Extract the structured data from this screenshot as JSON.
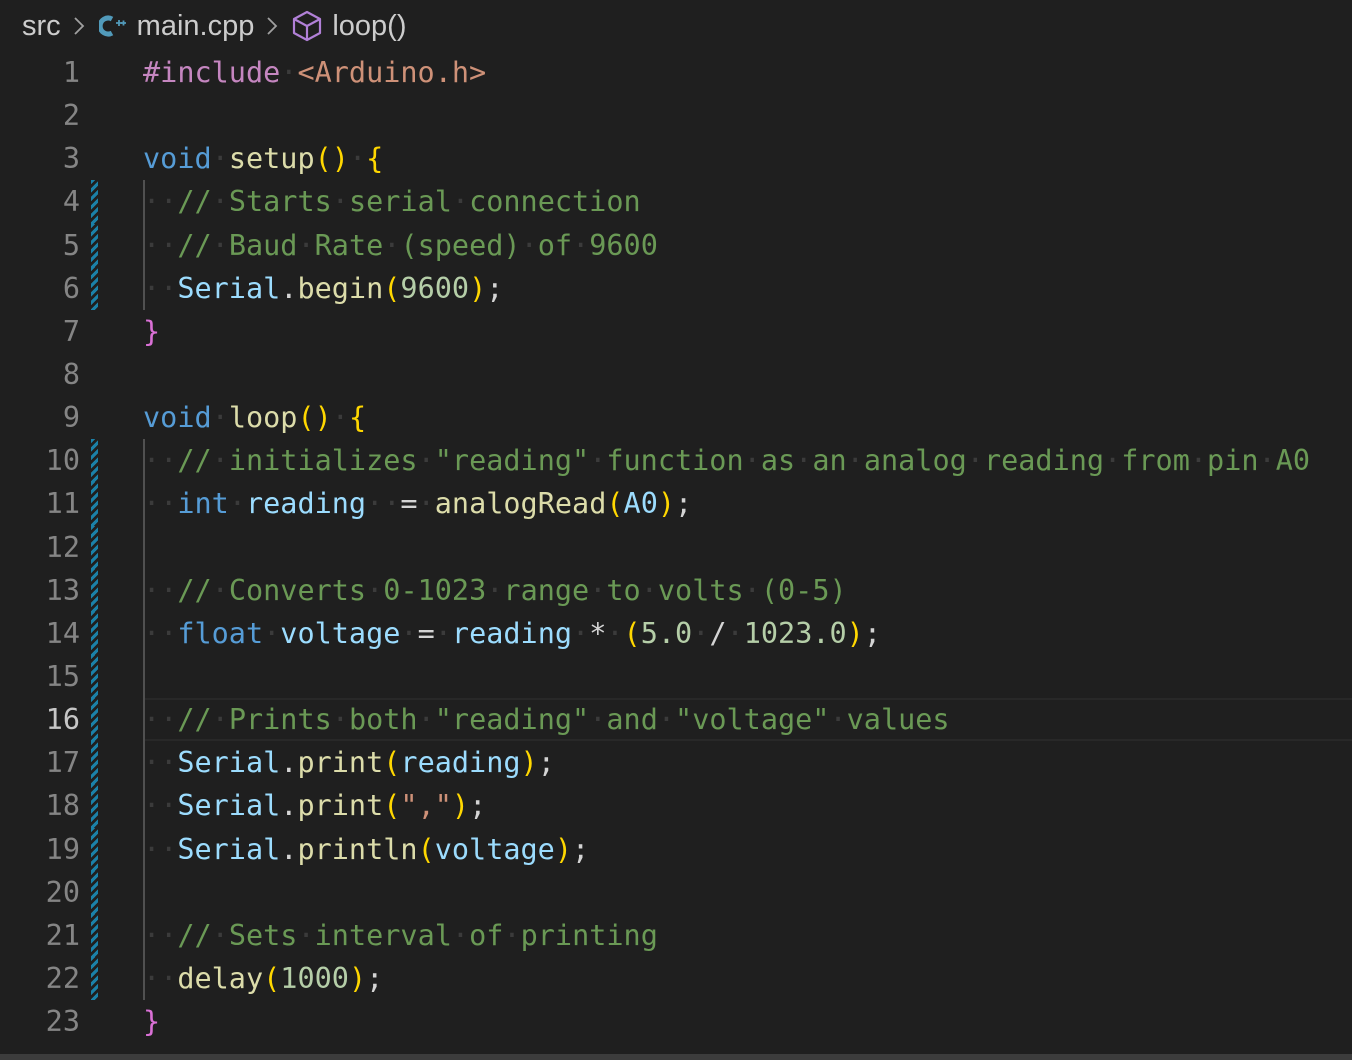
{
  "breadcrumb": {
    "folder": "src",
    "file": "main.cpp",
    "symbol": "loop()",
    "file_icon": "cpp-file-icon",
    "symbol_icon": "method-cube-icon"
  },
  "editor": {
    "language": "cpp",
    "current_line": 16,
    "lines": [
      {
        "n": "1",
        "text": "#include <Arduino.h>"
      },
      {
        "n": "2",
        "text": ""
      },
      {
        "n": "3",
        "text": "void setup() {"
      },
      {
        "n": "4",
        "text": "  // Starts serial connection"
      },
      {
        "n": "5",
        "text": "  // Baud Rate (speed) of 9600"
      },
      {
        "n": "6",
        "text": "  Serial.begin(9600);"
      },
      {
        "n": "7",
        "text": "}"
      },
      {
        "n": "8",
        "text": ""
      },
      {
        "n": "9",
        "text": "void loop() {"
      },
      {
        "n": "10",
        "text": "  // initializes \"reading\" function as an analog reading from pin A0"
      },
      {
        "n": "11",
        "text": "  int reading  = analogRead(A0);"
      },
      {
        "n": "12",
        "text": ""
      },
      {
        "n": "13",
        "text": "  // Converts 0-1023 range to volts (0-5)"
      },
      {
        "n": "14",
        "text": "  float voltage = reading * (5.0 / 1023.0);"
      },
      {
        "n": "15",
        "text": ""
      },
      {
        "n": "16",
        "text": "  // Prints both \"reading\" and \"voltage\" values"
      },
      {
        "n": "17",
        "text": "  Serial.print(reading);"
      },
      {
        "n": "18",
        "text": "  Serial.print(\",\");"
      },
      {
        "n": "19",
        "text": "  Serial.println(voltage);"
      },
      {
        "n": "20",
        "text": ""
      },
      {
        "n": "21",
        "text": "  // Sets interval of printing"
      },
      {
        "n": "22",
        "text": "  delay(1000);"
      },
      {
        "n": "23",
        "text": "}"
      }
    ],
    "modified_lines": [
      4,
      5,
      6,
      10,
      11,
      12,
      13,
      14,
      15,
      16,
      17,
      18,
      19,
      20,
      21,
      22
    ],
    "indent_guide_lines": [
      4,
      5,
      6,
      10,
      11,
      12,
      13,
      14,
      15,
      16,
      17,
      18,
      19,
      20,
      21,
      22
    ]
  }
}
